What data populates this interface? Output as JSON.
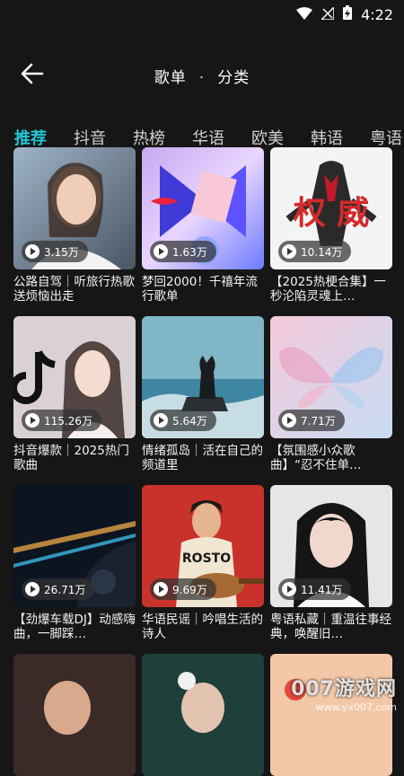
{
  "status": {
    "time": "4:22"
  },
  "header": {
    "back_icon": "arrow-left-icon",
    "title_left": "歌单",
    "separator": "·",
    "title_right": "分类"
  },
  "tabs": [
    {
      "label": "推荐",
      "active": true
    },
    {
      "label": "抖音"
    },
    {
      "label": "热榜"
    },
    {
      "label": "华语"
    },
    {
      "label": "欧美"
    },
    {
      "label": "韩语"
    },
    {
      "label": "粤语"
    }
  ],
  "cards": [
    {
      "plays": "3.15万",
      "title": "公路自驾｜听旅行热歌送烦恼出走"
    },
    {
      "plays": "1.63万",
      "title": "梦回2000！千禧年流行歌单"
    },
    {
      "plays": "10.14万",
      "title": "【2025热梗合集】一秒沦陷灵魂上…"
    },
    {
      "plays": "115.26万",
      "title": "抖音爆款｜2025热门歌曲"
    },
    {
      "plays": "5.64万",
      "title": "情绪孤岛｜活在自己的频道里"
    },
    {
      "plays": "7.71万",
      "title": "【氛围感小众歌曲】“忍不住单…"
    },
    {
      "plays": "26.71万",
      "title": "【劲爆车载DJ】动感嗨曲，一脚踩…"
    },
    {
      "plays": "9.69万",
      "title": "华语民谣｜吟唱生活的诗人"
    },
    {
      "plays": "11.41万",
      "title": "粤语私藏｜重温往事经典，唤醒旧…"
    }
  ],
  "cover_texts": {
    "card3": "权 威",
    "card8": "ROSTO"
  },
  "watermark": {
    "line1": "007游戏网",
    "line2": "www.yx007.com"
  },
  "colors": {
    "accent": "#22c7d6",
    "background": "#161616"
  }
}
